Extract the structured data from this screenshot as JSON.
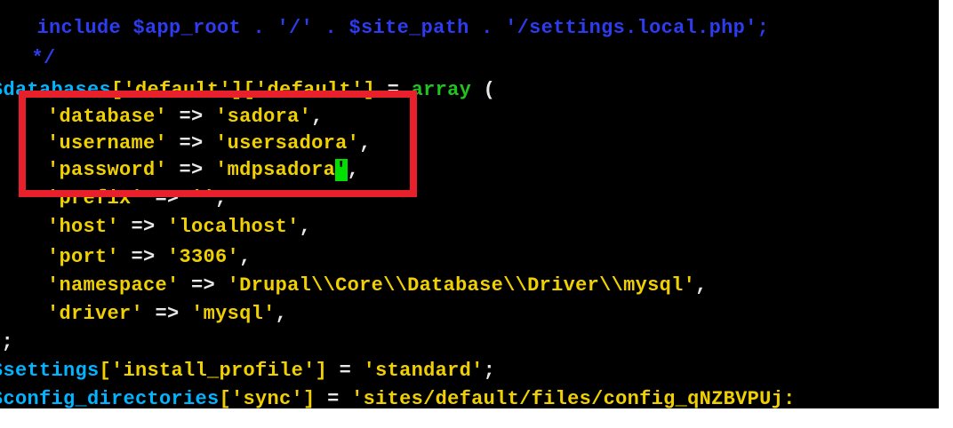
{
  "editor": {
    "lines": [
      {
        "id": "l1",
        "tokens": [
          {
            "text": " include $app_root . '/' . $site_path . '/settings.local.php';",
            "cls": "c-comment"
          }
        ]
      },
      {
        "id": "l2",
        "tokens": [
          {
            "text": " */",
            "cls": "c-comment"
          }
        ]
      },
      {
        "id": "l3",
        "tokens": [
          {
            "text": "$databases",
            "cls": "c-var-cyan"
          },
          {
            "text": "['default']['default']",
            "cls": "c-str"
          },
          {
            "text": " = ",
            "cls": "c-op"
          },
          {
            "text": "array",
            "cls": "c-kw"
          },
          {
            "text": " (",
            "cls": "c-op"
          }
        ]
      },
      {
        "id": "l4",
        "tokens": [
          {
            "text": "  ",
            "cls": "c-op"
          },
          {
            "text": "'database'",
            "cls": "c-str"
          },
          {
            "text": " => ",
            "cls": "c-op"
          },
          {
            "text": "'sadora'",
            "cls": "c-str"
          },
          {
            "text": ",",
            "cls": "c-op"
          }
        ]
      },
      {
        "id": "l5",
        "tokens": [
          {
            "text": "  ",
            "cls": "c-op"
          },
          {
            "text": "'username'",
            "cls": "c-str"
          },
          {
            "text": " => ",
            "cls": "c-op"
          },
          {
            "text": "'usersadora'",
            "cls": "c-str"
          },
          {
            "text": ",",
            "cls": "c-op"
          }
        ]
      },
      {
        "id": "l6",
        "tokens": [
          {
            "text": "  ",
            "cls": "c-op"
          },
          {
            "text": "'password'",
            "cls": "c-str"
          },
          {
            "text": " => ",
            "cls": "c-op"
          },
          {
            "text": "'mdpsadora",
            "cls": "c-str"
          },
          {
            "text": "'",
            "cls": "c-str cursor"
          },
          {
            "text": ",",
            "cls": "c-op"
          }
        ]
      },
      {
        "id": "l7",
        "tokens": [
          {
            "text": "  ",
            "cls": "c-op"
          },
          {
            "text": "'prefix'",
            "cls": "c-str"
          },
          {
            "text": " => ",
            "cls": "c-op"
          },
          {
            "text": "''",
            "cls": "c-str"
          },
          {
            "text": ",",
            "cls": "c-op"
          }
        ]
      },
      {
        "id": "l8",
        "tokens": [
          {
            "text": "  ",
            "cls": "c-op"
          },
          {
            "text": "'host'",
            "cls": "c-str"
          },
          {
            "text": " => ",
            "cls": "c-op"
          },
          {
            "text": "'localhost'",
            "cls": "c-str"
          },
          {
            "text": ",",
            "cls": "c-op"
          }
        ]
      },
      {
        "id": "l9",
        "tokens": [
          {
            "text": "  ",
            "cls": "c-op"
          },
          {
            "text": "'port'",
            "cls": "c-str"
          },
          {
            "text": " => ",
            "cls": "c-op"
          },
          {
            "text": "'3306'",
            "cls": "c-str"
          },
          {
            "text": ",",
            "cls": "c-op"
          }
        ]
      },
      {
        "id": "l10",
        "tokens": [
          {
            "text": "  ",
            "cls": "c-op"
          },
          {
            "text": "'namespace'",
            "cls": "c-str"
          },
          {
            "text": " => ",
            "cls": "c-op"
          },
          {
            "text": "'Drupal\\\\Core\\\\Database\\\\Driver\\\\mysql'",
            "cls": "c-str"
          },
          {
            "text": ",",
            "cls": "c-op"
          }
        ]
      },
      {
        "id": "l11",
        "tokens": [
          {
            "text": "  ",
            "cls": "c-op"
          },
          {
            "text": "'driver'",
            "cls": "c-str"
          },
          {
            "text": " => ",
            "cls": "c-op"
          },
          {
            "text": "'mysql'",
            "cls": "c-str"
          },
          {
            "text": ",",
            "cls": "c-op"
          }
        ]
      },
      {
        "id": "l12",
        "tokens": [
          {
            "text": ");",
            "cls": "c-op"
          }
        ]
      },
      {
        "id": "l13",
        "tokens": [
          {
            "text": "$settings",
            "cls": "c-var-cyan"
          },
          {
            "text": "['install_profile']",
            "cls": "c-str"
          },
          {
            "text": " = ",
            "cls": "c-op"
          },
          {
            "text": "'standard'",
            "cls": "c-str"
          },
          {
            "text": ";",
            "cls": "c-op"
          }
        ]
      },
      {
        "id": "l14",
        "tokens": [
          {
            "text": "$config_directories",
            "cls": "c-var-cyan"
          },
          {
            "text": "['sync']",
            "cls": "c-str"
          },
          {
            "text": " = ",
            "cls": "c-op"
          },
          {
            "text": "'sites/default/files/config_qNZBVPUj:",
            "cls": "c-str"
          }
        ]
      }
    ]
  },
  "colors": {
    "background": "#000000",
    "comment": "#2d3cf0",
    "string": "#f0d000",
    "keyword": "#1fc41f",
    "variable": "#00b4ff",
    "cursor": "#00e000",
    "highlight_box": "#e8202b"
  }
}
